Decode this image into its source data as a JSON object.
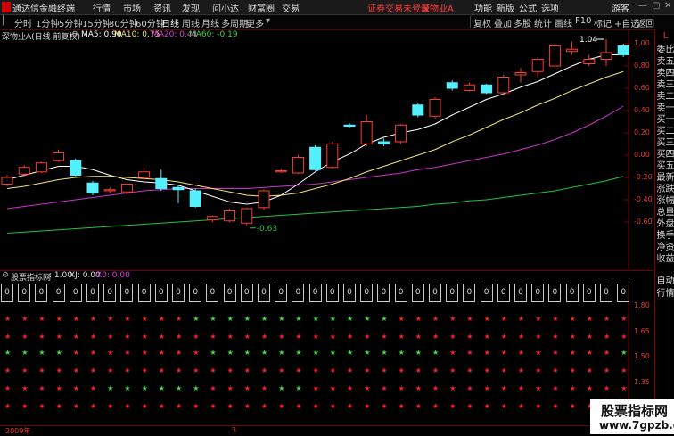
{
  "titlebar": {
    "app_title": "通达信金融终端",
    "menus": [
      "行情",
      "市场",
      "资讯",
      "发现",
      "问小达",
      "财富圈",
      "交易"
    ],
    "login_notice": "证券交易未登录",
    "stock_tag": "深物业A",
    "right_menus": [
      "功能",
      "新版",
      "公式",
      "选项"
    ],
    "guest": "游客"
  },
  "toolbar": {
    "periods": [
      "分时",
      "1分钟",
      "5分钟",
      "15分钟",
      "30分钟",
      "60分钟",
      "日线",
      "周线",
      "月线",
      "多周期",
      "更多"
    ],
    "active_period": "日线",
    "right_buttons": [
      "复权",
      "叠加",
      "多股",
      "统计",
      "画线",
      "F10",
      "标记",
      "+自选",
      "返回"
    ]
  },
  "legend": {
    "stock": "深物业A(日线 前复权)",
    "ma5": "MA5: 0.90",
    "ma10": "MA10: 0.75",
    "ma20": "MA20: 0.44",
    "ma60": "MA60: -0.19"
  },
  "colors": {
    "up": "#ff3b30",
    "down": "#54f0ff",
    "ma5": "#ffffff",
    "ma10": "#f3e27a",
    "ma20": "#cc33cc",
    "ma60": "#23c23c",
    "axis": "#e33333"
  },
  "main_axis": [
    "1.00",
    "0.80",
    "0.60",
    "0.40",
    "0.20",
    "0.00",
    "-0.20",
    "-0.40",
    "-0.60"
  ],
  "annotations": {
    "high": "1.04",
    "low": "-0.63"
  },
  "right_panel": [
    "L",
    "委比",
    "卖五",
    "卖四",
    "卖三",
    "卖二",
    "卖一",
    "买一",
    "买二",
    "买三",
    "买四",
    "买五",
    "最新",
    "涨跌",
    "涨幅",
    "总量",
    "外盘",
    "换手",
    "净资",
    "收益"
  ],
  "right_panel_bottom": [
    "自动",
    "行情"
  ],
  "indicator": {
    "title": "股票指标网",
    "value": ": 1.00",
    "xj": "XJ: 0.00",
    "x0": "X0: 0.00"
  },
  "sub_axis": [
    "1.80",
    "1.65",
    "1.50",
    "1.35",
    "1.20",
    "1.05"
  ],
  "box_label": "0",
  "star_glyph": "★",
  "bottom": {
    "year": "2009年",
    "month": "3"
  },
  "watermark": {
    "line1": "股票指标网",
    "line2": "www.7gpzb.com"
  },
  "candles": [
    {
      "o": -0.26,
      "c": -0.2,
      "h": -0.18,
      "l": -0.28
    },
    {
      "o": -0.17,
      "c": -0.11,
      "h": -0.09,
      "l": -0.19
    },
    {
      "o": -0.15,
      "c": -0.07,
      "h": -0.06,
      "l": -0.16
    },
    {
      "o": -0.05,
      "c": 0.02,
      "h": 0.05,
      "l": -0.06
    },
    {
      "o": -0.05,
      "c": -0.18,
      "h": -0.03,
      "l": -0.19
    },
    {
      "o": -0.25,
      "c": -0.34,
      "h": -0.23,
      "l": -0.36
    },
    {
      "o": -0.32,
      "c": -0.31,
      "h": -0.29,
      "l": -0.34
    },
    {
      "o": -0.33,
      "c": -0.26,
      "h": -0.24,
      "l": -0.35
    },
    {
      "o": -0.2,
      "c": -0.15,
      "h": -0.11,
      "l": -0.22
    },
    {
      "o": -0.21,
      "c": -0.3,
      "h": -0.13,
      "l": -0.32
    },
    {
      "o": -0.29,
      "c": -0.31,
      "h": -0.27,
      "l": -0.43
    },
    {
      "o": -0.32,
      "c": -0.46,
      "h": -0.3,
      "l": -0.47
    },
    {
      "o": -0.58,
      "c": -0.55,
      "h": -0.54,
      "l": -0.6
    },
    {
      "o": -0.59,
      "c": -0.5,
      "h": -0.48,
      "l": -0.6
    },
    {
      "o": -0.61,
      "c": -0.48,
      "h": -0.47,
      "l": -0.63
    },
    {
      "o": -0.47,
      "c": -0.32,
      "h": -0.31,
      "l": -0.49
    },
    {
      "o": -0.15,
      "c": -0.14,
      "h": -0.12,
      "l": -0.16
    },
    {
      "o": -0.16,
      "c": -0.02,
      "h": 0.0,
      "l": -0.17
    },
    {
      "o": 0.07,
      "c": -0.13,
      "h": 0.09,
      "l": -0.14
    },
    {
      "o": -0.11,
      "c": 0.1,
      "h": 0.12,
      "l": -0.12
    },
    {
      "o": 0.27,
      "c": 0.26,
      "h": 0.29,
      "l": 0.24
    },
    {
      "o": 0.1,
      "c": 0.3,
      "h": 0.36,
      "l": 0.08
    },
    {
      "o": 0.12,
      "c": 0.1,
      "h": 0.15,
      "l": 0.08
    },
    {
      "o": 0.12,
      "c": 0.27,
      "h": 0.28,
      "l": 0.1
    },
    {
      "o": 0.45,
      "c": 0.36,
      "h": 0.47,
      "l": 0.34
    },
    {
      "o": 0.35,
      "c": 0.5,
      "h": 0.52,
      "l": 0.33
    },
    {
      "o": 0.65,
      "c": 0.6,
      "h": 0.67,
      "l": 0.58
    },
    {
      "o": 0.58,
      "c": 0.63,
      "h": 0.65,
      "l": 0.57
    },
    {
      "o": 0.63,
      "c": 0.56,
      "h": 0.64,
      "l": 0.55
    },
    {
      "o": 0.56,
      "c": 0.7,
      "h": 0.72,
      "l": 0.54
    },
    {
      "o": 0.72,
      "c": 0.74,
      "h": 0.78,
      "l": 0.65
    },
    {
      "o": 0.75,
      "c": 0.86,
      "h": 0.88,
      "l": 0.7
    },
    {
      "o": 0.8,
      "c": 0.98,
      "h": 1.0,
      "l": 0.78
    },
    {
      "o": 0.93,
      "c": 0.95,
      "h": 1.02,
      "l": 0.9
    },
    {
      "o": 0.82,
      "c": 0.86,
      "h": 0.9,
      "l": 0.8
    },
    {
      "o": 0.86,
      "c": 0.92,
      "h": 1.04,
      "l": 0.8
    },
    {
      "o": 0.98,
      "c": 0.9,
      "h": 1.0,
      "l": 0.88
    }
  ],
  "ma5": [
    -0.22,
    -0.18,
    -0.14,
    -0.1,
    -0.1,
    -0.13,
    -0.18,
    -0.22,
    -0.24,
    -0.25,
    -0.27,
    -0.32,
    -0.37,
    -0.42,
    -0.44,
    -0.42,
    -0.36,
    -0.26,
    -0.15,
    -0.06,
    0.01,
    0.1,
    0.16,
    0.2,
    0.23,
    0.28,
    0.36,
    0.43,
    0.5,
    0.55,
    0.61,
    0.66,
    0.73,
    0.8,
    0.86,
    0.9,
    0.9
  ],
  "ma10": [
    -0.3,
    -0.28,
    -0.25,
    -0.22,
    -0.2,
    -0.19,
    -0.19,
    -0.2,
    -0.21,
    -0.22,
    -0.24,
    -0.27,
    -0.3,
    -0.33,
    -0.36,
    -0.37,
    -0.36,
    -0.34,
    -0.3,
    -0.26,
    -0.21,
    -0.15,
    -0.1,
    -0.05,
    0.0,
    0.05,
    0.12,
    0.18,
    0.25,
    0.32,
    0.38,
    0.45,
    0.51,
    0.58,
    0.64,
    0.7,
    0.75
  ],
  "ma20": [
    -0.48,
    -0.46,
    -0.44,
    -0.42,
    -0.4,
    -0.38,
    -0.36,
    -0.34,
    -0.32,
    -0.31,
    -0.3,
    -0.3,
    -0.3,
    -0.3,
    -0.3,
    -0.29,
    -0.28,
    -0.27,
    -0.26,
    -0.24,
    -0.22,
    -0.2,
    -0.18,
    -0.16,
    -0.13,
    -0.11,
    -0.08,
    -0.05,
    -0.02,
    0.01,
    0.05,
    0.09,
    0.14,
    0.2,
    0.27,
    0.35,
    0.44
  ],
  "ma60": [
    -0.7,
    -0.69,
    -0.68,
    -0.67,
    -0.66,
    -0.65,
    -0.64,
    -0.63,
    -0.62,
    -0.61,
    -0.6,
    -0.59,
    -0.58,
    -0.57,
    -0.56,
    -0.55,
    -0.54,
    -0.53,
    -0.52,
    -0.51,
    -0.5,
    -0.49,
    -0.48,
    -0.47,
    -0.46,
    -0.44,
    -0.43,
    -0.41,
    -0.4,
    -0.38,
    -0.36,
    -0.34,
    -0.32,
    -0.29,
    -0.26,
    -0.23,
    -0.19
  ],
  "boxes": [
    true,
    true,
    true,
    true,
    true,
    true,
    true,
    true,
    true,
    true,
    true,
    true,
    true,
    true,
    true,
    true,
    true,
    true,
    true,
    true,
    true,
    true,
    true,
    true,
    true,
    true,
    true,
    true,
    true,
    true,
    true,
    true,
    true,
    true,
    true,
    true,
    true
  ],
  "star_rows": [
    {
      "colors": "rrrrrrrrrrrggggggggggggrrrrrrrrrrrrrr"
    },
    {
      "colors": "rrrrrrrrrrrrrrrrrrrrrrrrrrrrrrrrrrrrr"
    },
    {
      "colors": "ggggrrrrrrrrggggggggggggggrrrrrrrrrrg"
    },
    {
      "colors": "rrrrrrrrrrrrrrrrrrrrrrrrrrrrrrrrrrrrr"
    },
    {
      "colors": "rrrrrrggggggrrrrggrrrrrrrrrrrrrrrrrrr"
    },
    {
      "colors": "rrrrrrrrrrrrrrrrrrrrrrrrrrrrrrrrrrrrr"
    }
  ]
}
